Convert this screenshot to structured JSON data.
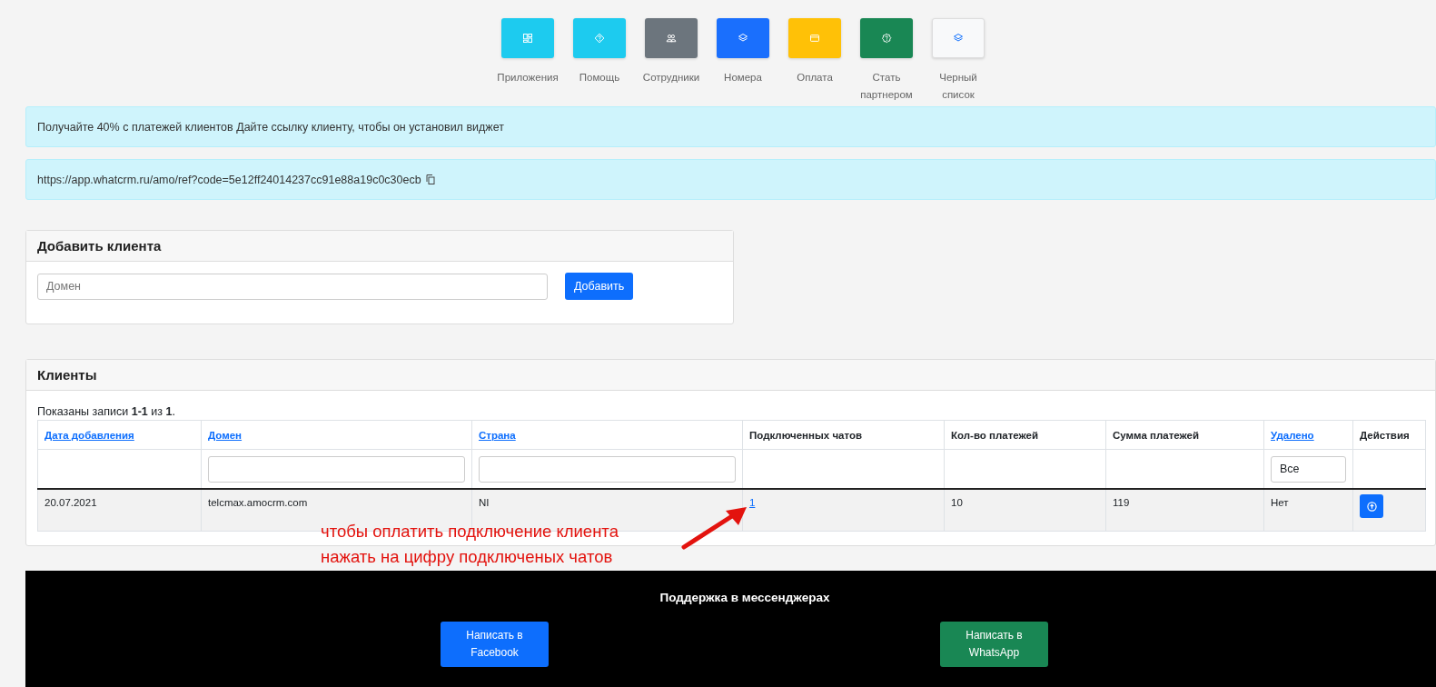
{
  "nav": [
    {
      "label": "Приложения",
      "color": "#1dcbef"
    },
    {
      "label": "Помощь",
      "color": "#1dcbef"
    },
    {
      "label": "Сотрудники",
      "color": "#6c757d"
    },
    {
      "label": "Номера",
      "color": "#1a6ffd"
    },
    {
      "label": "Оплата",
      "color": "#ffc107"
    },
    {
      "label": "Стать партнером",
      "color": "#198754"
    },
    {
      "label": "Черный список",
      "color": "#f8f9fa"
    }
  ],
  "alerts": [
    {
      "kind": "text",
      "text": "Получайте 40% с платежей клиентов Дайте ссылку клиенту, чтобы он установил виджет"
    },
    {
      "kind": "copy",
      "text": "https://app.whatcrm.ru/amo/ref?code=5e12ff24014237cc91e88a19c0c30ecb"
    }
  ],
  "add_client": {
    "title": "Добавить клиента",
    "placeholder": "Домен",
    "button": "Добавить"
  },
  "clients": {
    "title": "Клиенты",
    "summary": "Показаны записи **1-1** из **1**.",
    "columns": [
      {
        "label": "Дата добавления",
        "sortable": true
      },
      {
        "label": "Домен",
        "sortable": true
      },
      {
        "label": "Страна",
        "sortable": true
      },
      {
        "label": "Подключенных чатов",
        "sortable": false
      },
      {
        "label": "Кол-во платежей",
        "sortable": false
      },
      {
        "label": "Сумма платежей",
        "sortable": false
      },
      {
        "label": "Удалено",
        "sortable": true
      },
      {
        "label": "Действия",
        "sortable": false
      }
    ],
    "filters": [
      {
        "kind": "none"
      },
      {
        "kind": "text"
      },
      {
        "kind": "text"
      },
      {
        "kind": "none"
      },
      {
        "kind": "none"
      },
      {
        "kind": "none"
      },
      {
        "kind": "select",
        "value": "Все"
      },
      {
        "kind": "none"
      }
    ],
    "rows": [
      {
        "cells": [
          {
            "kind": "text",
            "text": "20.07.2021"
          },
          {
            "kind": "text",
            "text": "telcmax.amocrm.com"
          },
          {
            "kind": "text",
            "text": "NI"
          },
          {
            "kind": "link",
            "text": "1"
          },
          {
            "kind": "text",
            "text": "10"
          },
          {
            "kind": "text",
            "text": "119"
          },
          {
            "kind": "text",
            "text": "Нет"
          },
          {
            "kind": "action"
          }
        ]
      }
    ],
    "annotation": [
      "чтобы оплатить подключение клиента",
      "нажать на цифру подключеных чатов"
    ]
  },
  "footer": {
    "title": "Поддержка в мессенджерах",
    "buttons": [
      {
        "label": "Написать в Facebook",
        "color": "#0d6efd"
      },
      {
        "label": "Написать в WhatsApp",
        "color": "#198754"
      }
    ]
  }
}
